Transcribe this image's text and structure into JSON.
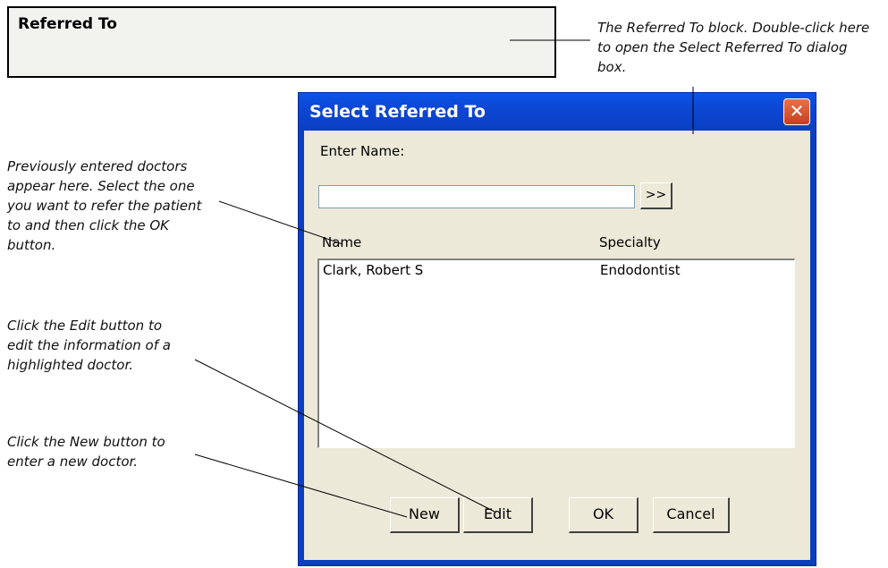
{
  "referred_block": {
    "title": "Referred To"
  },
  "callouts": {
    "block": [
      "The Referred To block. Double-click here",
      "to open the Select Referred To dialog",
      "box."
    ],
    "list": [
      "Previously entered doctors",
      "appear here. Select the one",
      "you want to refer the patient",
      "to and then click the OK",
      "button."
    ],
    "edit": [
      "Click the Edit button to",
      "edit the information of a",
      "highlighted doctor."
    ],
    "new": [
      "Click the New button to",
      "enter a new doctor."
    ]
  },
  "dialog": {
    "title": "Select Referred To",
    "close_icon": "close-x-icon",
    "enter_name_label": "Enter Name:",
    "name_value": "",
    "search_button": ">>",
    "columns": [
      "Name",
      "Specialty"
    ],
    "rows": [
      {
        "name": "Clark, Robert S",
        "specialty": "Endodontist"
      }
    ],
    "buttons": {
      "new": "New",
      "edit": "Edit",
      "ok": "OK",
      "cancel": "Cancel"
    }
  },
  "colors": {
    "titlebar": "#0a3fc2",
    "dialog_body": "#ece9d8",
    "close": "#d8542c"
  }
}
